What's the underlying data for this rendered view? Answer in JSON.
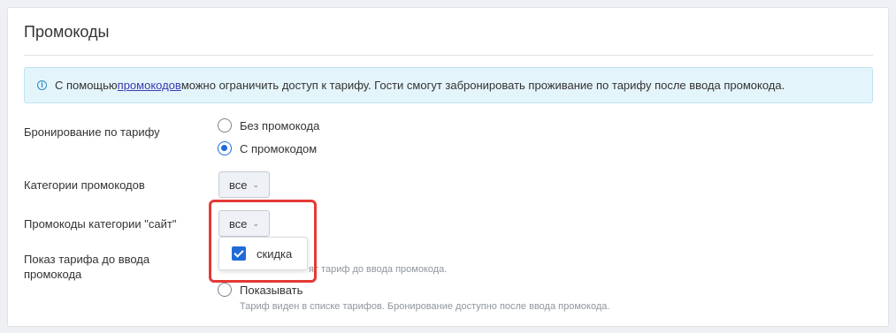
{
  "section": {
    "title": "Промокоды"
  },
  "info": {
    "icon": "info-icon",
    "prefix": "С помощью ",
    "link": "промокодов",
    "suffix": " можно ограничить доступ к тарифу. Гости смогут забронировать проживание по тарифу после ввода промокода."
  },
  "booking": {
    "label": "Бронирование по тарифу",
    "options": [
      {
        "label": "Без промокода",
        "checked": false
      },
      {
        "label": "С промокодом",
        "checked": true
      }
    ]
  },
  "categories": {
    "label": "Категории промокодов",
    "value": "все"
  },
  "site_promos": {
    "label": "Промокоды категории \"сайт\"",
    "value": "все",
    "menu_items": [
      {
        "label": "скидка",
        "checked": true
      }
    ]
  },
  "show_tariff": {
    "label": "Показ тарифа до ввода промокода",
    "hidden_hint_fragment": "ят тариф до ввода промокода.",
    "option_show": "Показывать",
    "option_show_hint": "Тариф виден в списке тарифов. Бронирование доступно после ввода промокода."
  },
  "colors": {
    "accent": "#1f6bd8",
    "highlight": "#e53935",
    "info_bg": "#e4f4fb"
  }
}
